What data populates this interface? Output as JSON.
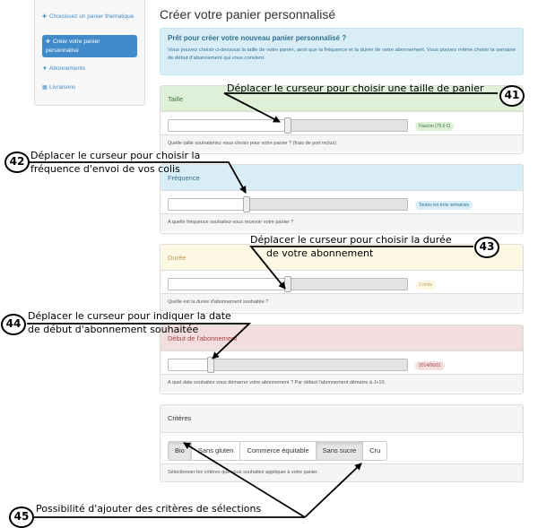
{
  "sidebar": {
    "items": [
      {
        "label": "Choisissez un panier thématique",
        "icon": "plus-icon"
      },
      {
        "label": "Créer votre panier personnalisé",
        "icon": "plus-icon",
        "active": true
      },
      {
        "label": "Abonnements",
        "icon": "cart-icon"
      },
      {
        "label": "Livraisons",
        "icon": "calendar-icon"
      }
    ]
  },
  "main": {
    "title": "Créer votre panier personnalisé",
    "info": {
      "heading": "Prêt pour créer votre nouveau panier personnalisé ?",
      "text": "Vous pouvez choisir ci-dessous la taille de votre panier, ainsi que la fréquence et la durée de votre abonnement. Vous pouvez même choisir la semaine de début d'abonnement qui vous convient."
    },
    "panels": {
      "taille": {
        "title": "Taille",
        "value": "Faucon (75.0 €)",
        "level": 0.5,
        "help": "Quelle taille souhaiteriez vous choisir pour votre panier ? (frais de port inclus)"
      },
      "frequence": {
        "title": "Fréquence",
        "value": "Toutes les trois semaines",
        "level": 0.33,
        "help": "A quelle fréquence souhaitez-vous recevoir votre panier ?"
      },
      "duree": {
        "title": "Durée",
        "value": "3 mois",
        "level": 0.5,
        "help": "Quelle est la durée d'abonnement souhaitée ?"
      },
      "debut": {
        "title": "Début de l'abonnement",
        "value": "2014/06/01",
        "level": 0.18,
        "help": "A quel date souhaitez vous démarrer votre abonnement ? Par défaut l'abonnement démarre à J+10."
      }
    },
    "criteres": {
      "title": "Critères",
      "options": [
        {
          "label": "Bio",
          "selected": true
        },
        {
          "label": "Sans gluten",
          "selected": false
        },
        {
          "label": "Commerce équitable",
          "selected": false
        },
        {
          "label": "Sans sucre",
          "selected": true
        },
        {
          "label": "Cru",
          "selected": false
        }
      ],
      "help": "Sélectionner les critères que vous souhaitez appliquer à votre panier."
    }
  },
  "annotations": [
    {
      "number": "41",
      "text": "Déplacer le curseur pour choisir une taille de panier"
    },
    {
      "number": "42",
      "text_line1": "Déplacer le curseur pour choisir la",
      "text_line2": "fréquence d'envoi de vos colis"
    },
    {
      "number": "43",
      "text_line1": "Déplacer le curseur pour choisir la durée",
      "text_line2": "de votre abonnement"
    },
    {
      "number": "44",
      "text_line1": "Déplacer le curseur pour indiquer la date",
      "text_line2": "de début d'abonnement souhaitée"
    },
    {
      "number": "45",
      "text": "Possibilité d'ajouter des critères de sélections"
    }
  ],
  "colors": {
    "primary": "#428bca",
    "success_bg": "#dff0d8",
    "info_bg": "#d9edf7",
    "warning_bg": "#fcf8e3",
    "danger_bg": "#f2dede"
  }
}
